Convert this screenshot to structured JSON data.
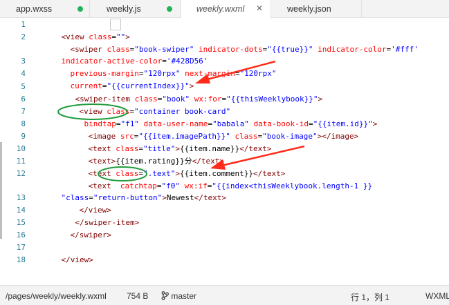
{
  "tabs": [
    {
      "label": "app.wxss",
      "modified": true
    },
    {
      "label": "weekly.js",
      "modified": true
    },
    {
      "label": "weekly.wxml",
      "active": true,
      "close": "✕"
    },
    {
      "label": "weekly.json"
    }
  ],
  "editor": {
    "line_numbers": [
      "1",
      "2",
      "3",
      "4",
      "5",
      "6",
      "7",
      "8",
      "9",
      "10",
      "11",
      "12",
      "13",
      "14",
      "15",
      "16",
      "17",
      "18"
    ],
    "lines": {
      "l1": {
        "a": "<view ",
        "b": "class",
        "c": "=",
        "d": "\"\"",
        "e": ">"
      },
      "l2": {
        "a": "<swiper ",
        "b": "class",
        "c": "=",
        "d": "\"book-swiper\"",
        "e": " ",
        "f": "indicator-dots",
        "g": "=",
        "h": "\"{{true}}\"",
        "i": " ",
        "j": "indicator-color",
        "k": "=",
        "l": "'#fff'"
      },
      "l2b": {
        "a": "indicator-active-color",
        "b": "=",
        "c": "'#428D56'"
      },
      "l3": {
        "a": "previous-margin",
        "b": "=",
        "c": "\"120rpx\"",
        "d": " ",
        "e": "next-margin",
        "f": "=",
        "g": "\"120rpx\""
      },
      "l4": {
        "a": "current",
        "b": "=",
        "c": "\"{{currentIndex}}\"",
        "d": ">"
      },
      "l5": {
        "a": "<swiper-item ",
        "b": "class",
        "c": "=",
        "d": "\"book\"",
        "e": " ",
        "f": "wx:for",
        "g": "=",
        "h": "\"{{thisWeeklybook}}\"",
        "i": ">"
      },
      "l6": {
        "a": "<view ",
        "b": "class",
        "c": "=",
        "d": "\"container book-card\""
      },
      "l7": {
        "a": "bindtap",
        "b": "=",
        "c": "\"f1\"",
        "d": " ",
        "e": "data-user-name",
        "f": "=",
        "g": "\"babala\"",
        "h": " ",
        "i": "data-book-id",
        "j": "=",
        "k": "\"{{item.id}}\"",
        "l": ">"
      },
      "l8": {
        "a": "<image ",
        "b": "src",
        "c": "=",
        "d": "\"{{item.imagePath}}\"",
        "e": " ",
        "f": "class",
        "g": "=",
        "h": "\"book-image\"",
        "i": "></image>"
      },
      "l9": {
        "a": "<text ",
        "b": "class",
        "c": "=",
        "d": "\"title\"",
        "e": ">",
        "f": "{{item.name}}",
        "g": "</text>"
      },
      "l10": {
        "a": "<text>",
        "b": "{{item.rating}}分",
        "c": "</text>"
      },
      "l11": {
        "a": "<text ",
        "b": "class",
        "c": "=",
        "d": "\".text\"",
        "e": ">",
        "f": "{{item.comment}}",
        "g": "</text>"
      },
      "l12": {
        "a": "<text  ",
        "b": "catchtap",
        "c": "=",
        "d": "\"f0\"",
        "e": " ",
        "f": "wx:if",
        "g": "=",
        "h": "\"{{index<thisWeeklybook.length-1 }}"
      },
      "l12b": {
        "a": "\"class",
        "b": "=",
        "c": "\"return-button\"",
        "d": ">",
        "e": "Newest",
        "f": "</text>"
      },
      "l13": {
        "a": "</view>"
      },
      "l14": {
        "a": "</swiper-item>"
      },
      "l15": {
        "a": "</swiper>"
      },
      "l17": {
        "a": "</view>"
      }
    }
  },
  "status": {
    "path": "/pages/weekly/weekly.wxml",
    "size": "754 B",
    "branch": "master",
    "position": "行 1，列 1",
    "language": "WXML"
  },
  "colors": {
    "tag": "#800000",
    "attr": "#ff0000",
    "value": "#0000ff",
    "annotation_arrow": "#ff2a1a",
    "annotation_circle": "#1f9b3a",
    "modified_dot": "#23b356"
  }
}
